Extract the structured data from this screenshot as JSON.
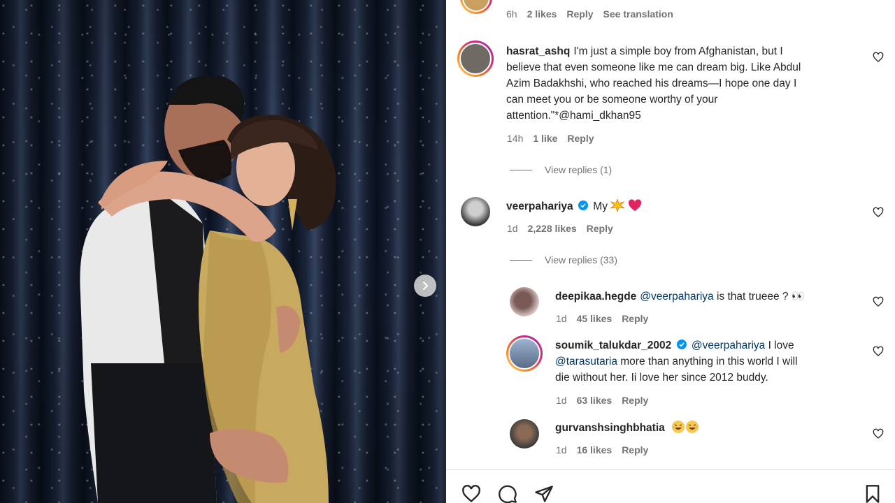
{
  "top_partial": {
    "time": "6h",
    "likes": "2 likes",
    "reply": "Reply",
    "see_translation": "See translation"
  },
  "comments": [
    {
      "username": "hasrat_ashq",
      "text": "I'm just a simple boy from Afghanistan, but I believe that even someone like me can dream big. Like Abdul Azim Badakhshi, who reached his dreams—I hope one day I can meet you or be someone worthy of your attention.\"*@hami_dkhan95",
      "line1": "I'm just a simple boy from Afghanistan, but I",
      "line2": "believe that even someone like me can dream big. Like Abdul",
      "line3": "Azim Badakhshi, who reached his dreams—I hope one day I",
      "line4": "can meet you or be someone worthy of your",
      "line5": "attention.\"*@hami_dkhan95",
      "time": "14h",
      "likes": "1 like",
      "reply": "Reply",
      "view_replies": "View replies (1)"
    },
    {
      "username": "veerpahariya",
      "text": "My 💥❤️",
      "text_plain": "My",
      "time": "1d",
      "likes": "2,228 likes",
      "reply": "Reply",
      "view_replies": "View replies (33)"
    }
  ],
  "replies": [
    {
      "username": "deepikaa.hegde",
      "mention": "@veerpahariya",
      "text": " is that trueee ? 👀",
      "time": "1d",
      "likes": "45 likes",
      "reply": "Reply"
    },
    {
      "username": "soumik_talukdar_2002",
      "mention": "@veerpahariya",
      "text_a": " I love",
      "mention2": "@tarasutaria",
      "text_b": " more than anything in this world I will",
      "text_c": "die without her. Ii love her since 2012 buddy.",
      "time": "1d",
      "likes": "63 likes",
      "reply": "Reply"
    },
    {
      "username": "gurvanshsinghbhatia",
      "text": "😂😂",
      "time": "1d",
      "likes": "16 likes",
      "reply": "Reply"
    }
  ],
  "icons": {
    "like": "heart-icon",
    "comment": "comment-icon",
    "share": "share-icon",
    "save": "bookmark-icon",
    "next": "chevron-right-icon",
    "verified": "verified-badge-icon"
  },
  "colors": {
    "mention": "#00376b",
    "meta": "#737373",
    "verified": "#0095f6"
  }
}
